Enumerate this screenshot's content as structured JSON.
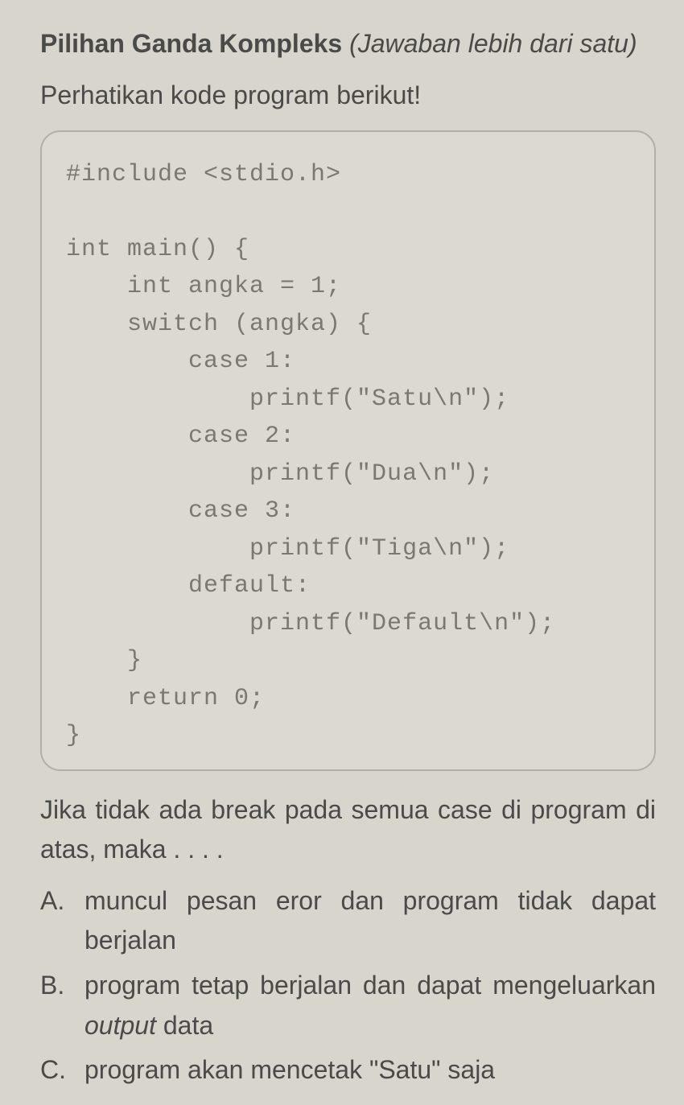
{
  "heading": {
    "bold": "Pilihan Ganda Kompleks",
    "italic": "(Jawaban lebih dari satu)"
  },
  "instruction": "Perhatikan kode program berikut!",
  "code": "#include <stdio.h>\n\nint main() {\n    int angka = 1;\n    switch (angka) {\n        case 1:\n            printf(\"Satu\\n\");\n        case 2:\n            printf(\"Dua\\n\");\n        case 3:\n            printf(\"Tiga\\n\");\n        default:\n            printf(\"Default\\n\");\n    }\n    return 0;\n}",
  "question": "Jika tidak ada break pada semua case di program di atas, maka . . . .",
  "options": [
    {
      "letter": "A.",
      "text": "muncul pesan eror dan program tidak dapat berjalan"
    },
    {
      "letter": "B.",
      "text_parts": [
        "program tetap berjalan dan dapat mengeluarkan ",
        "output",
        " data"
      ]
    },
    {
      "letter": "C.",
      "text": "program akan mencetak \"Satu\" saja"
    }
  ]
}
